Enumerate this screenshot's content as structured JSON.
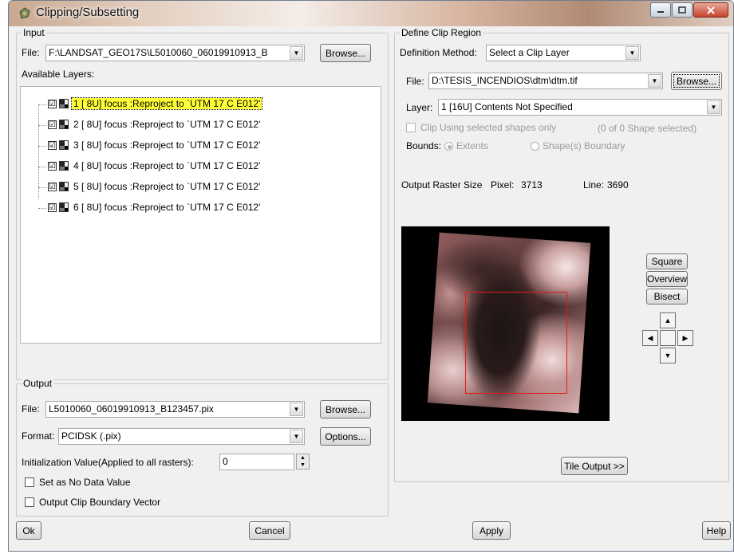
{
  "window": {
    "title": "Clipping/Subsetting",
    "icon": "pci-app-icon"
  },
  "input": {
    "legend": "Input",
    "file_label": "File:",
    "file_value": "F:\\LANDSAT_GEO17S\\L5010060_06019910913_B",
    "browse_label": "Browse...",
    "available_layers_label": "Available Layers:",
    "layers": [
      {
        "checked": "☑",
        "text": "1 [ 8U] focus  :Reproject to `UTM    17 C E012'",
        "selected": true
      },
      {
        "checked": "☑",
        "text": "2 [ 8U] focus  :Reproject to `UTM    17 C E012'",
        "selected": false
      },
      {
        "checked": "☑",
        "text": "3 [ 8U] focus  :Reproject to `UTM    17 C E012'",
        "selected": false
      },
      {
        "checked": "☑",
        "text": "4 [ 8U] focus  :Reproject to `UTM    17 C E012'",
        "selected": false
      },
      {
        "checked": "☑",
        "text": "5 [ 8U] focus  :Reproject to `UTM    17 C E012'",
        "selected": false
      },
      {
        "checked": "☑",
        "text": "6 [ 8U] focus  :Reproject to `UTM    17 C E012'",
        "selected": false
      }
    ]
  },
  "output": {
    "legend": "Output",
    "file_label": "File:",
    "file_value": "L5010060_06019910913_B123457.pix",
    "browse_label": "Browse...",
    "format_label": "Format:",
    "format_value": "PCIDSK (.pix)",
    "options_label": "Options...",
    "init_label": "Initialization Value(Applied to all rasters):",
    "init_value": "0",
    "nodata_label": "Set as No Data Value",
    "clip_vector_label": "Output Clip Boundary Vector"
  },
  "clip_region": {
    "legend": "Define Clip Region",
    "method_label": "Definition Method:",
    "method_value": "Select a Clip Layer",
    "file_label": "File:",
    "file_value": "D:\\TESIS_INCENDIOS\\dtm\\dtm.tif",
    "browse_label": "Browse...",
    "layer_label": "Layer:",
    "layer_value": "1 [16U] Contents Not Specified",
    "clip_selected_label": "Clip Using selected shapes only",
    "shape_count_text": "(0  of  0 Shape selected)",
    "bounds_label": "Bounds:",
    "bounds_extents": "Extents",
    "bounds_shapes": "Shape(s) Boundary",
    "raster_size_label": "Output Raster Size",
    "pixel_label": "Pixel:",
    "pixel_value": "3713",
    "line_label": "Line:",
    "line_value": "3690",
    "square_label": "Square",
    "overview_label": "Overview",
    "bisect_label": "Bisect",
    "tile_output_label": "Tile Output >>"
  },
  "footer": {
    "ok_label": "Ok",
    "cancel_label": "Cancel",
    "apply_label": "Apply",
    "help_label": "Help"
  }
}
